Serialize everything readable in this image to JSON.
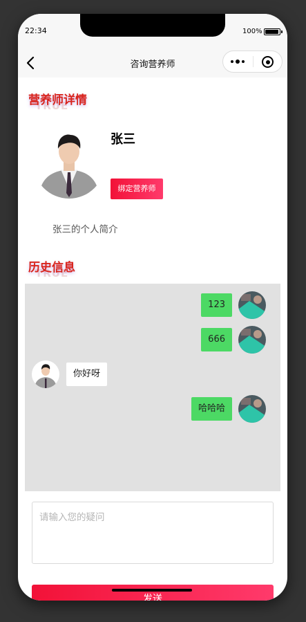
{
  "status_bar": {
    "time": "22:34",
    "battery_percent": "100%",
    "battery_level": 1.0
  },
  "nav": {
    "title": "咨询营养师",
    "back_icon": "chevron-left-icon",
    "menu_icon": "more-dots-icon",
    "close_icon": "target-circle-icon"
  },
  "section_detail": {
    "title": "营养师详情",
    "shadow": "TRUE"
  },
  "nutritionist": {
    "name": "张三",
    "bind_label": "绑定营养师",
    "bio": "张三的个人简介",
    "photo_icon": "person-suit-photo"
  },
  "section_history": {
    "title": "历史信息",
    "shadow": "TRUE"
  },
  "messages": [
    {
      "side": "mine",
      "text": "123"
    },
    {
      "side": "mine",
      "text": "666"
    },
    {
      "side": "theirs",
      "text": "你好呀"
    },
    {
      "side": "mine",
      "text": "哈哈哈"
    }
  ],
  "input": {
    "placeholder": "请输入您的疑问",
    "value": ""
  },
  "send": {
    "label": "发送"
  },
  "colors": {
    "accent_red": "#d9241b",
    "button_gradient_start": "#f21238",
    "button_gradient_end": "#ff3a6b",
    "bubble_green": "#4cd964",
    "chat_bg": "#e1e1e1",
    "page_bg": "#333333"
  }
}
